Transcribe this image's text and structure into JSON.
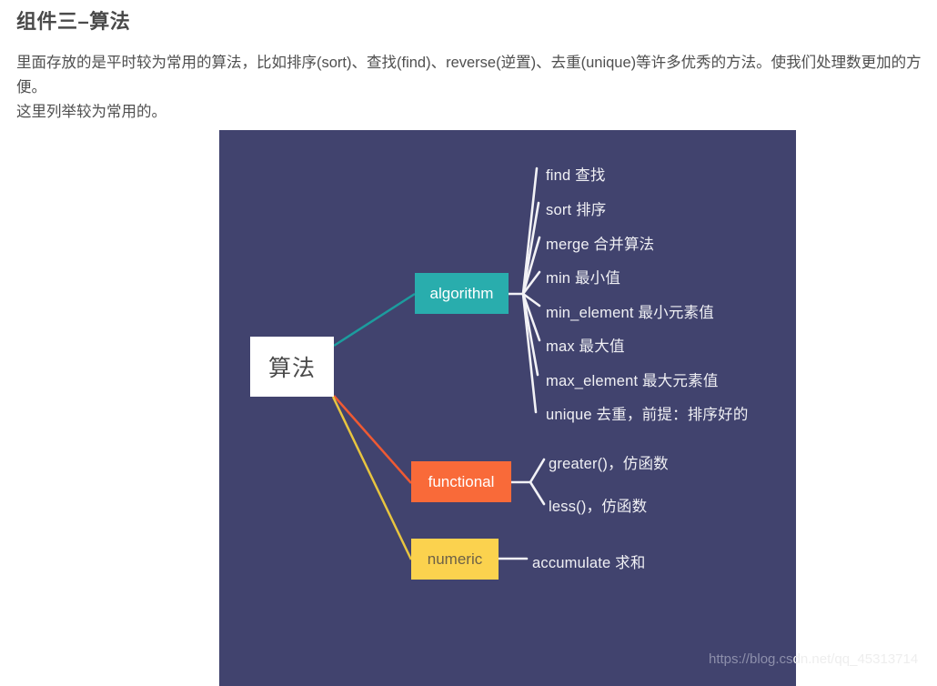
{
  "article": {
    "title": "组件三–算法",
    "paragraph_1": "里面存放的是平时较为常用的算法，比如排序(sort)、查找(find)、reverse(逆置)、去重(unique)等许多优秀的方法。使我们处理数更加的方便。",
    "paragraph_2": "这里列举较为常用的。"
  },
  "mindmap": {
    "background_color": "#41436e",
    "root": {
      "label": "算法",
      "color": "#ffffff",
      "text_color": "#4a4a4a"
    },
    "branches": [
      {
        "label": "algorithm",
        "color": "#29adad",
        "text_color": "#ffffff",
        "link_color": "#1c9c9e",
        "children": [
          "find 查找",
          "sort 排序",
          "merge 合并算法",
          "min 最小值",
          "min_element 最小元素值",
          "max 最大值",
          "max_element 最大元素值",
          "unique 去重，前提：排序好的"
        ]
      },
      {
        "label": "functional",
        "color": "#f96a39",
        "text_color": "#ffffff",
        "link_color": "#ef5a33",
        "children": [
          "greater()，仿函数",
          "less()，仿函数"
        ]
      },
      {
        "label": "numeric",
        "color": "#fbd24e",
        "text_color": "#6d6147",
        "link_color": "#e8c53f",
        "children": [
          "accumulate 求和"
        ]
      }
    ],
    "watermark": {
      "inside": "https://blog.cs",
      "outside": "dn.net/qq_45313714"
    }
  }
}
